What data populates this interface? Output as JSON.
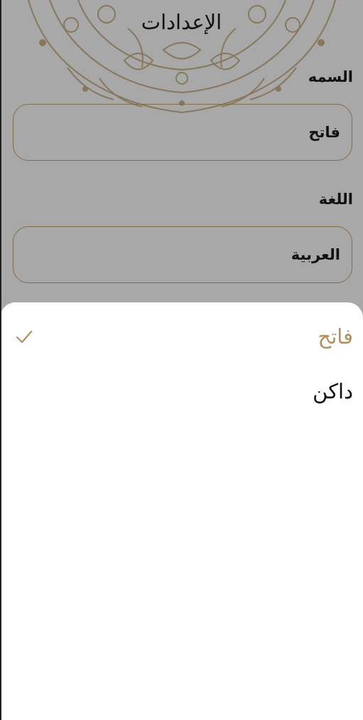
{
  "header": {
    "title": "الإعدادات"
  },
  "settings": {
    "theme_label": "السمه",
    "theme_value": "فاتح",
    "language_label": "اللغة",
    "language_value": "العربية"
  },
  "theme_sheet": {
    "options": [
      {
        "label": "فاتح",
        "selected": true
      },
      {
        "label": "داكن",
        "selected": false
      }
    ]
  },
  "colors": {
    "accent": "#b0905e",
    "field_border": "#c4a475",
    "overlay": "rgba(0,0,0,0.34)"
  },
  "icons": {
    "selected_indicator": "check-icon"
  }
}
